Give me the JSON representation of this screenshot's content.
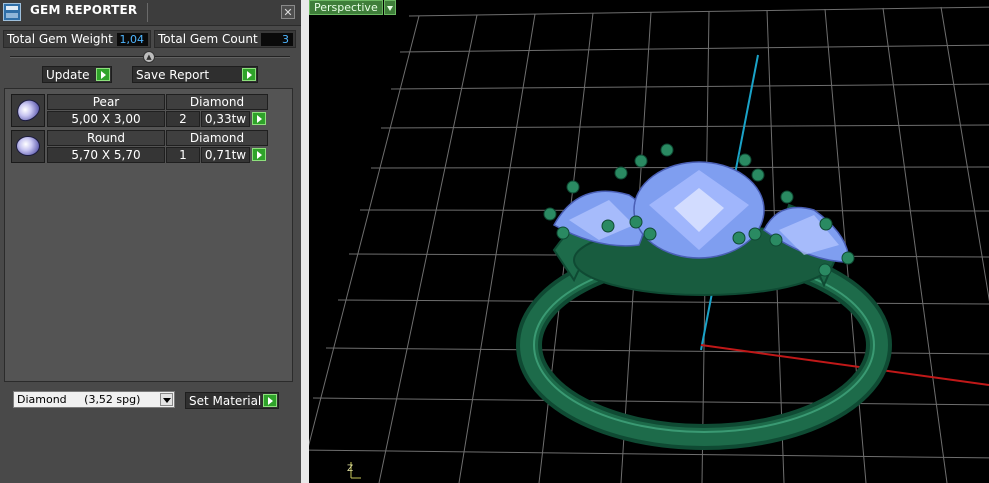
{
  "window": {
    "title": "GEM REPORTER",
    "close_label": "✕"
  },
  "stats": {
    "total_weight_label": "Total Gem Weight",
    "total_weight_value": "1,04",
    "total_count_label": "Total Gem Count",
    "total_count_value": "3"
  },
  "buttons": {
    "update": "Update",
    "save_report": "Save Report",
    "set_material": "Set Material"
  },
  "gems": [
    {
      "shape": "Pear",
      "size": "5,00 X 3,00",
      "material": "Diamond",
      "count": "2",
      "weight": "0,33tw",
      "icon": "pear-gem-icon"
    },
    {
      "shape": "Round",
      "size": "5,70 X 5,70",
      "material": "Diamond",
      "count": "1",
      "weight": "0,71tw",
      "icon": "round-gem-icon"
    }
  ],
  "material_select": {
    "value": "Diamond     (3,52 spg)"
  },
  "viewport": {
    "view_label": "Perspective",
    "axis_label": "Z"
  },
  "colors": {
    "accent_green": "#2fa32a",
    "ring_green": "#1d6b4a",
    "gem_blue": "#7f9ef0",
    "value_blue": "#4fb6ff",
    "x_axis": "#c01818",
    "y_axis": "#1aa3c8"
  }
}
